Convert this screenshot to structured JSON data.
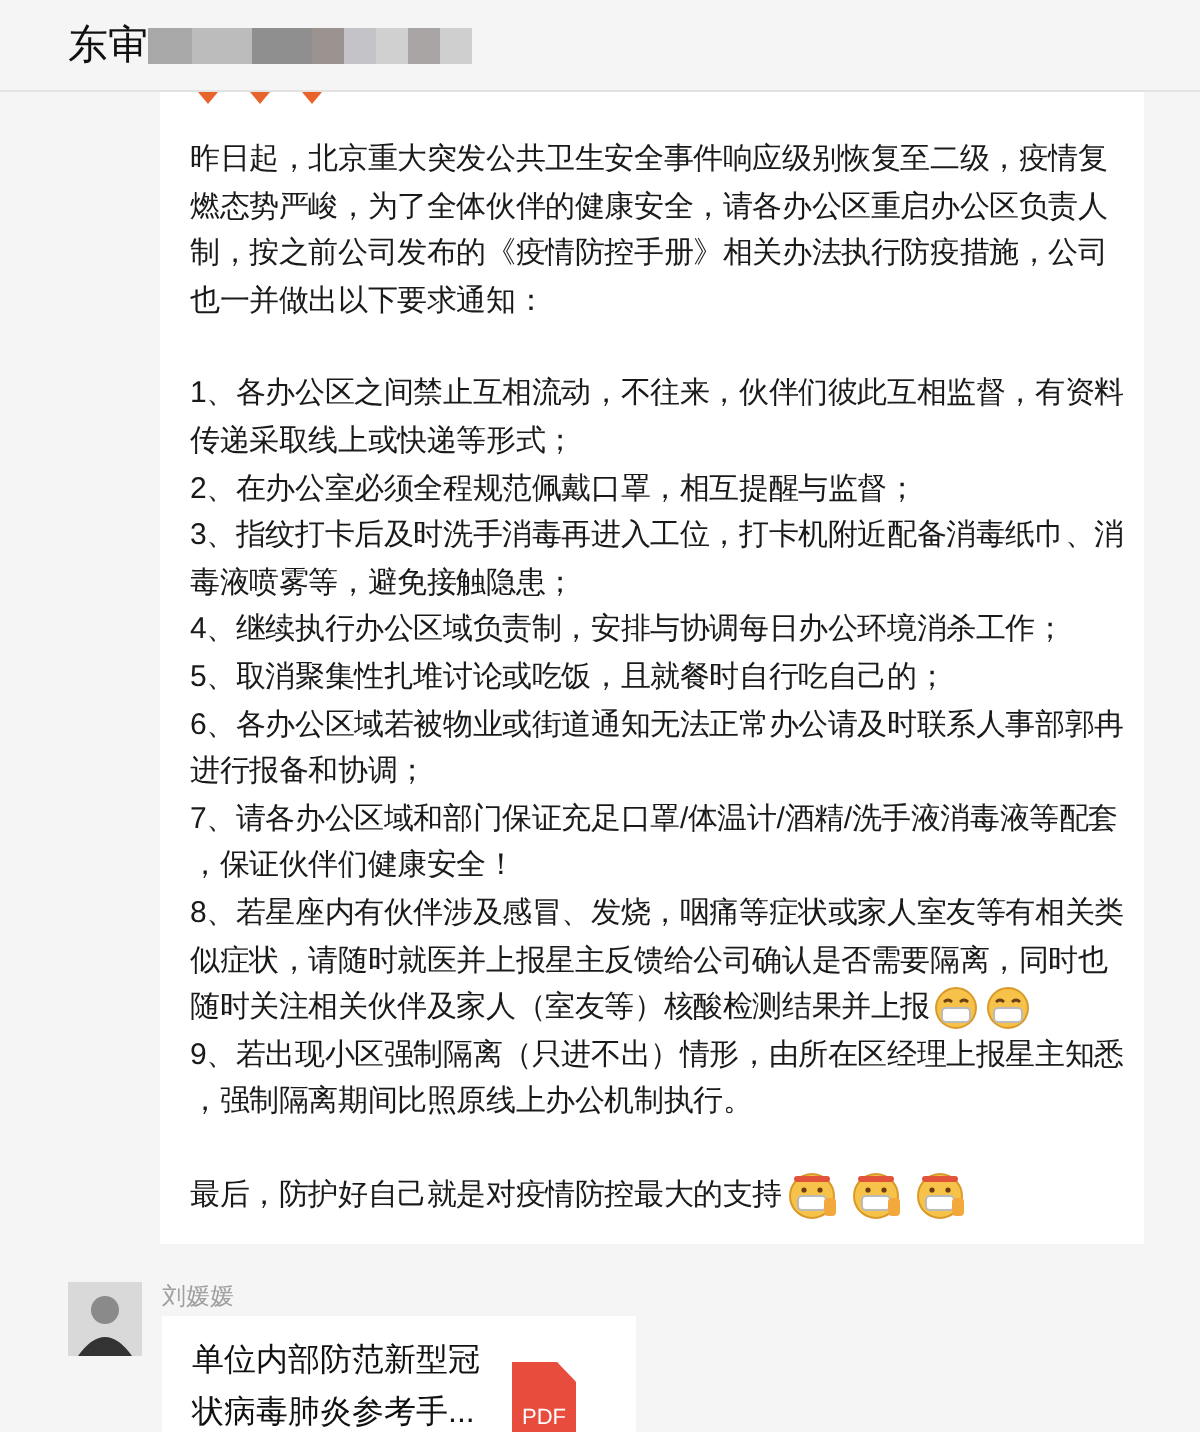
{
  "chat": {
    "title": "东审"
  },
  "message": {
    "intro": "昨日起，北京重大突发公共卫生安全事件响应级别恢复至二级，疫情复燃态势严峻，为了全体伙伴的健康安全，请各办公区重启办公区负责人制，按之前公司发布的《疫情防控手册》相关办法执行防疫措施，公司也一并做出以下要求通知：",
    "items": [
      {
        "text": "1、各办公区之间禁止互相流动，不往来，伙伴们彼此互相监督，有资料传递采取线上或快递等形式；"
      },
      {
        "text": "2、在办公室必须全程规范佩戴口罩，相互提醒与监督；"
      },
      {
        "text": "3、指纹打卡后及时洗手消毒再进入工位，打卡机附近配备消毒纸巾、消毒液喷雾等，避免接触隐患；"
      },
      {
        "text": "4、继续执行办公区域负责制，安排与协调每日办公环境消杀工作；"
      },
      {
        "text": "5、取消聚集性扎堆讨论或吃饭，且就餐时自行吃自己的；"
      },
      {
        "text": "6、各办公区域若被物业或街道通知无法正常办公请及时联系人事部郭冉进行报备和协调；"
      },
      {
        "text": "7、请各办公区域和部门保证充足口罩/体温计/酒精/洗手液消毒液等配套，保证伙伴们健康安全！"
      },
      {
        "text": "8、若星座内有伙伴涉及感冒、发烧，咽痛等症状或家人室友等有相关类似症状，请随时就医并上报星主反馈给公司确认是否需要隔离，同时也随时关注相关伙伴及家人（室友等）核酸检测结果并上报",
        "emojis": [
          {
            "kind": "mask"
          },
          {
            "kind": "mask"
          }
        ]
      },
      {
        "text": "9、若出现小区强制隔离（只进不出）情形，由所在区经理上报星主知悉，强制隔离期间比照原线上办公机制执行。"
      }
    ],
    "closing": {
      "text": "最后，防护好自己就是对疫情防控最大的支持",
      "emojis": [
        {
          "kind": "mask-thumb"
        },
        {
          "kind": "mask-thumb"
        },
        {
          "kind": "mask-thumb"
        }
      ]
    }
  },
  "file_message": {
    "sender": "刘媛媛",
    "file_name": "单位内部防范新型冠状病毒肺炎参考手...",
    "file_type": "PDF"
  }
}
